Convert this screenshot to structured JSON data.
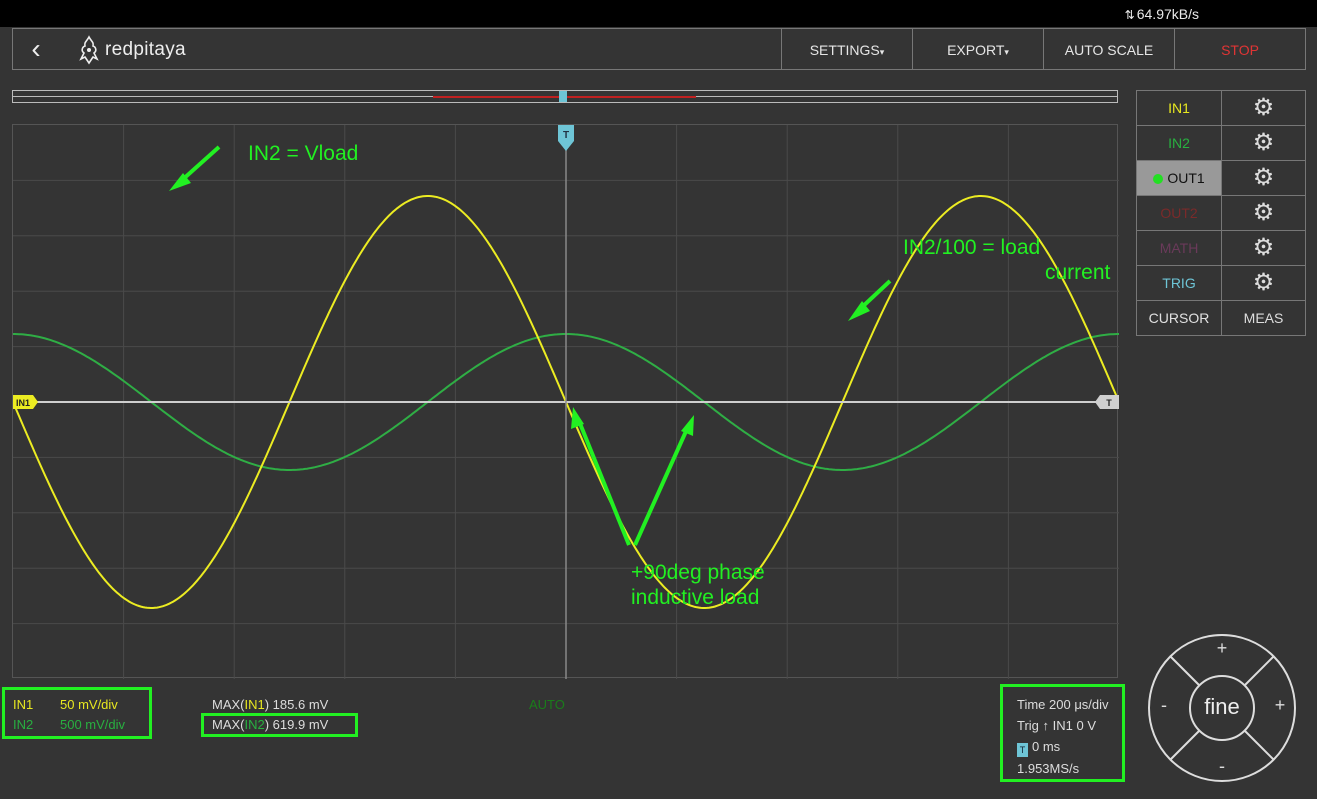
{
  "status": {
    "speed": "64.97kB/s"
  },
  "nav": {
    "logo": "redpitaya",
    "settings": "SETTINGS",
    "export": "EXPORT",
    "autoscale": "AUTO SCALE",
    "stop": "STOP"
  },
  "channels": [
    {
      "label": "IN1",
      "color": "#e8e820"
    },
    {
      "label": "IN2",
      "color": "#28b040"
    },
    {
      "label": "OUT1",
      "color": "#111111"
    },
    {
      "label": "OUT2",
      "color": "#7a2a2a"
    },
    {
      "label": "MATH",
      "color": "#6a3a5a"
    },
    {
      "label": "TRIG",
      "color": "#6ec5d6"
    }
  ],
  "tools": {
    "cursor": "CURSOR",
    "meas": "MEAS"
  },
  "scale": {
    "in1_label": "IN1",
    "in1_value": "50 mV/div",
    "in2_label": "IN2",
    "in2_value": "500 mV/div"
  },
  "measurements": {
    "m1_pre": "MAX(",
    "m1_ch": "IN1",
    "m1_post": ") 185.6 mV",
    "m2_pre": "MAX(",
    "m2_ch": "IN2",
    "m2_post": ") 619.9 mV"
  },
  "trigger_mode": "AUTO",
  "timebase": {
    "time": "Time 200 μs/div",
    "trig_pre": "Trig",
    "trig_post": "IN1 0 V",
    "offset": "0 ms",
    "rate": "1.953MS/s"
  },
  "markers": {
    "trig_top": "T",
    "in1_marker": "IN1",
    "trig_right": "T"
  },
  "knob": {
    "center": "fine",
    "plus_top": "+",
    "minus_left": "-",
    "plus_right": "+",
    "minus_bottom": "-"
  },
  "annotations": {
    "vload": "IN2 = Vload",
    "current_1": "IN2/100 = load",
    "current_2": "current",
    "phase_1": "+90deg phase",
    "phase_2": "inductive load"
  }
}
